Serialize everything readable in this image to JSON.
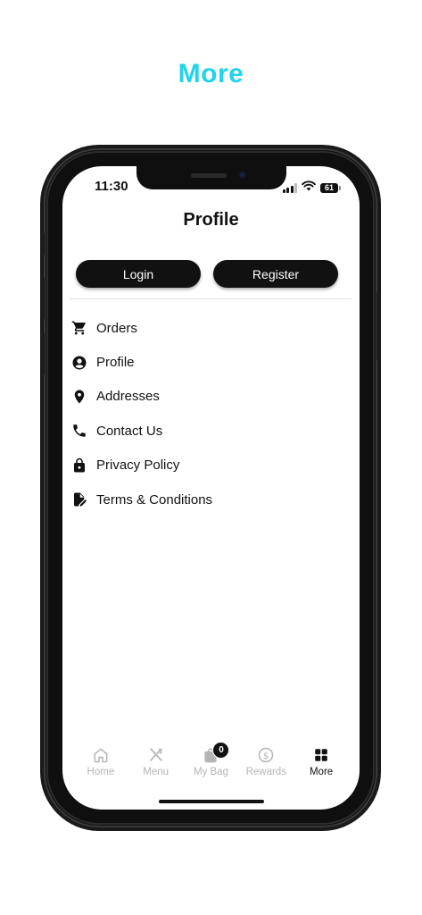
{
  "headline": "More",
  "status_bar": {
    "time": "11:30",
    "battery": "61"
  },
  "header": {
    "title": "Profile"
  },
  "auth": {
    "login_label": "Login",
    "register_label": "Register"
  },
  "menu": {
    "items": [
      {
        "label": "Orders",
        "icon": "cart-icon"
      },
      {
        "label": "Profile",
        "icon": "account-circle-icon"
      },
      {
        "label": "Addresses",
        "icon": "location-pin-icon"
      },
      {
        "label": "Contact Us",
        "icon": "phone-icon"
      },
      {
        "label": "Privacy Policy",
        "icon": "lock-icon"
      },
      {
        "label": "Terms & Conditions",
        "icon": "document-edit-icon"
      }
    ]
  },
  "tabbar": {
    "items": [
      {
        "label": "Home",
        "icon": "home-icon",
        "active": false
      },
      {
        "label": "Menu",
        "icon": "utensils-icon",
        "active": false
      },
      {
        "label": "My Bag",
        "icon": "bag-icon",
        "active": false,
        "badge": "0"
      },
      {
        "label": "Rewards",
        "icon": "dollar-circle-icon",
        "active": false
      },
      {
        "label": "More",
        "icon": "grid-icon",
        "active": true
      }
    ]
  },
  "colors": {
    "headline": "#22d3ee",
    "button_bg": "#111111",
    "tab_inactive": "#b5b5b5",
    "tab_active": "#111111"
  }
}
